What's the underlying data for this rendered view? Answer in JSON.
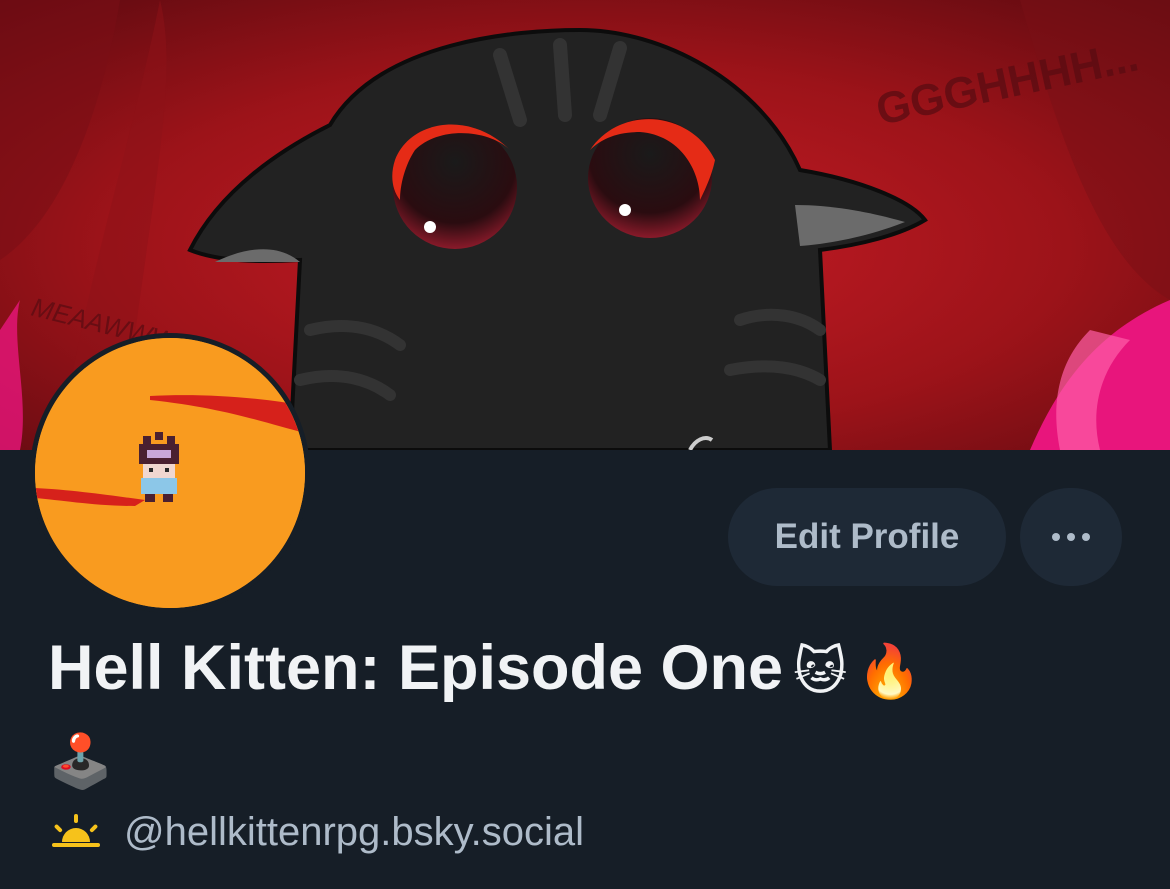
{
  "banner": {
    "name": "hell-kitten-banner",
    "texts": {
      "top_right": "GGGHHHH...",
      "left": "MEAAWWW..."
    }
  },
  "avatar": {
    "name": "hell-kitten-pixel-avatar"
  },
  "actions": {
    "edit_profile_label": "Edit Profile",
    "more_icon": "more-horizontal-icon"
  },
  "profile": {
    "display_name": "Hell Kitten: Episode One",
    "name_emojis": [
      "🐱",
      "🔥",
      "🕹️"
    ],
    "handle": "@hellkittenrpg.bsky.social",
    "handle_icon": "sunrise-icon"
  },
  "colors": {
    "background": "#161e27",
    "button_bg": "#1e2936",
    "button_text": "#aebbc9",
    "name_text": "#f1f3f5",
    "handle_text": "#aebbc9",
    "banner_red": "#a3121a",
    "avatar_orange": "#f99b1f"
  }
}
